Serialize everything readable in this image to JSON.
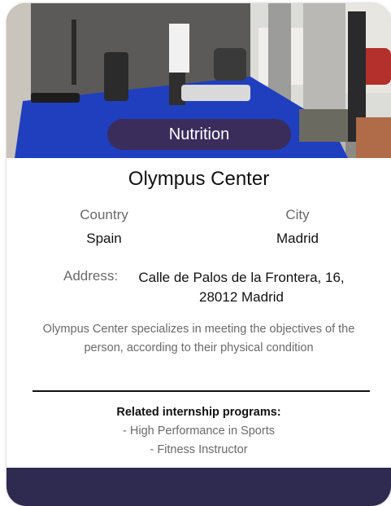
{
  "card": {
    "badge": "Nutrition",
    "title": "Olympus Center",
    "country": {
      "label": "Country",
      "value": "Spain"
    },
    "city": {
      "label": "City",
      "value": "Madrid"
    },
    "address": {
      "label": "Address:",
      "value": "Calle de Palos de la Frontera, 16, 28012 Madrid"
    },
    "description": "Olympus Center specializes in meeting the objectives of the person, according to their physical condition",
    "related": {
      "title": "Related internship programs:",
      "programs": [
        "- High Performance in Sports",
        "- Fitness Instructor"
      ]
    }
  },
  "colors": {
    "badge_bg": "#3a2d5c",
    "footer_bg": "#2f2a50",
    "floor_blue": "#1f3fbf"
  }
}
